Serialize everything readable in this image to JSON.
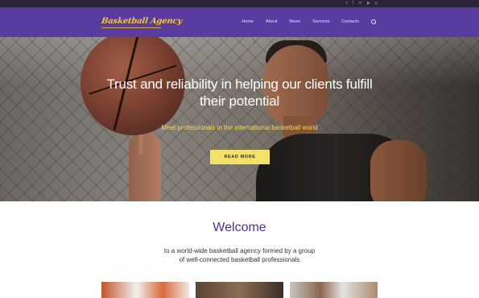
{
  "topbar": {
    "social_icons": [
      "twitter-icon",
      "facebook-icon",
      "linkedin-icon",
      "youtube-icon",
      "pinterest-icon"
    ],
    "social_glyphs": [
      "t",
      "f",
      "in",
      "▶",
      "p"
    ]
  },
  "header": {
    "logo_text": "Basketball Agency",
    "nav": [
      "Home",
      "About",
      "News",
      "Services",
      "Contacts"
    ]
  },
  "hero": {
    "title": "Trust and reliability in helping our clients fulfill their potential",
    "subtitle": "Meet professionals in the international basketball world",
    "button_label": "READ MORE"
  },
  "welcome": {
    "title": "Welcome",
    "line1": "to a world-wide basketball agency formed by a group",
    "line2": "of well-connected basketball professionals"
  },
  "colors": {
    "brand_purple": "#5a3ca0",
    "accent_yellow": "#f3e16a",
    "topbar": "#2a2436"
  }
}
